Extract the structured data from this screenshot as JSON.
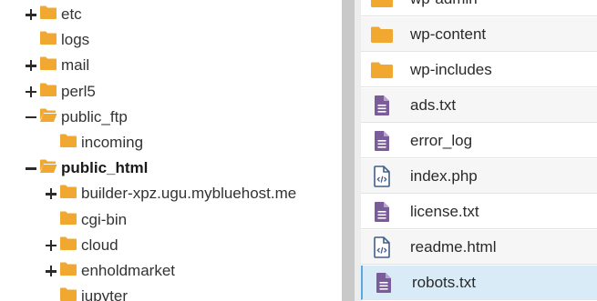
{
  "tree": [
    {
      "label": "etc",
      "toggle": "plus",
      "depth": 0,
      "bold": false,
      "open": false
    },
    {
      "label": "logs",
      "toggle": "none",
      "depth": 0,
      "bold": false,
      "open": false
    },
    {
      "label": "mail",
      "toggle": "plus",
      "depth": 0,
      "bold": false,
      "open": false
    },
    {
      "label": "perl5",
      "toggle": "plus",
      "depth": 0,
      "bold": false,
      "open": false
    },
    {
      "label": "public_ftp",
      "toggle": "minus",
      "depth": 0,
      "bold": false,
      "open": true
    },
    {
      "label": "incoming",
      "toggle": "none",
      "depth": 1,
      "bold": false,
      "open": false
    },
    {
      "label": "public_html",
      "toggle": "minus",
      "depth": 0,
      "bold": true,
      "open": true
    },
    {
      "label": "builder-xpz.ugu.mybluehost.me",
      "toggle": "plus",
      "depth": 1,
      "bold": false,
      "open": false
    },
    {
      "label": "cgi-bin",
      "toggle": "none",
      "depth": 1,
      "bold": false,
      "open": false
    },
    {
      "label": "cloud",
      "toggle": "plus",
      "depth": 1,
      "bold": false,
      "open": false
    },
    {
      "label": "enholdmarket",
      "toggle": "plus",
      "depth": 1,
      "bold": false,
      "open": false
    },
    {
      "label": "jupyter",
      "toggle": "none",
      "depth": 1,
      "bold": false,
      "open": false
    }
  ],
  "files": [
    {
      "name": "wp-admin",
      "icon": "folder-icon"
    },
    {
      "name": "wp-content",
      "icon": "folder-icon"
    },
    {
      "name": "wp-includes",
      "icon": "folder-icon"
    },
    {
      "name": "ads.txt",
      "icon": "text-file-icon"
    },
    {
      "name": "error_log",
      "icon": "text-file-icon"
    },
    {
      "name": "index.php",
      "icon": "code-file-icon"
    },
    {
      "name": "license.txt",
      "icon": "text-file-icon"
    },
    {
      "name": "readme.html",
      "icon": "code-file-icon"
    },
    {
      "name": "robots.txt",
      "icon": "text-file-icon",
      "selected": true
    }
  ],
  "colors": {
    "folder": "#f0a830",
    "text_file": "#7b5c9a",
    "code_file": "#3f5f8a",
    "selection": "#d9ebf7"
  }
}
